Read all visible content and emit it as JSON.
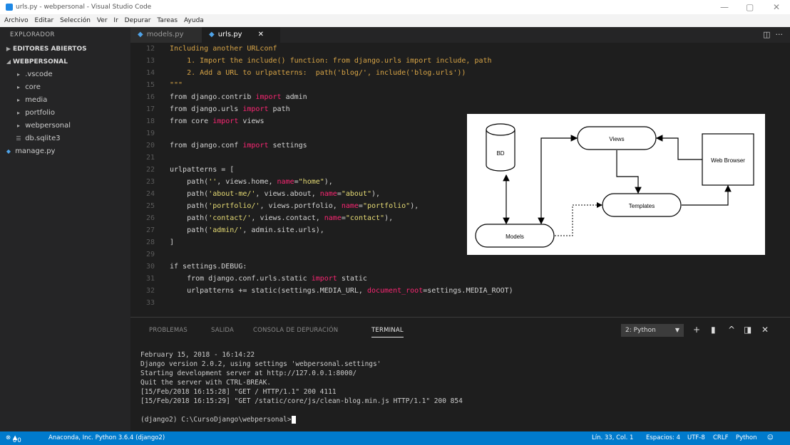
{
  "window": {
    "title": "urls.py - webpersonal - Visual Studio Code"
  },
  "menu": [
    "Archivo",
    "Editar",
    "Selección",
    "Ver",
    "Ir",
    "Depurar",
    "Tareas",
    "Ayuda"
  ],
  "sidebar": {
    "header": "EXPLORADOR",
    "sections": [
      {
        "label": "EDITORES ABIERTOS",
        "expanded": false
      },
      {
        "label": "WEBPERSONAL",
        "expanded": true
      }
    ],
    "items": [
      {
        "label": ".vscode",
        "icon": "chevron-right-icon"
      },
      {
        "label": "core",
        "icon": "chevron-right-icon"
      },
      {
        "label": "media",
        "icon": "chevron-right-icon"
      },
      {
        "label": "portfolio",
        "icon": "chevron-right-icon"
      },
      {
        "label": "webpersonal",
        "icon": "chevron-right-icon"
      },
      {
        "label": "db.sqlite3",
        "icon": "database-file-icon"
      },
      {
        "label": "manage.py",
        "icon": "python-file-icon"
      }
    ]
  },
  "tabs": [
    {
      "label": "models.py",
      "active": false
    },
    {
      "label": "urls.py",
      "active": true
    }
  ],
  "editor": {
    "lines": [
      {
        "n": "12",
        "tokens": [
          [
            "cmt",
            "Including another URLconf"
          ]
        ]
      },
      {
        "n": "13",
        "tokens": [
          [
            "cmt",
            "    1. Import the include() function: from django.urls import include, path"
          ]
        ]
      },
      {
        "n": "14",
        "tokens": [
          [
            "cmt",
            "    2. Add a URL to urlpatterns:  path('blog/', include('blog.urls'))"
          ]
        ]
      },
      {
        "n": "15",
        "tokens": [
          [
            "cmt",
            "\"\"\""
          ]
        ]
      },
      {
        "n": "16",
        "tokens": [
          [
            "code",
            "from django.contrib "
          ],
          [
            "kw",
            "import"
          ],
          [
            "code",
            " admin"
          ]
        ]
      },
      {
        "n": "17",
        "tokens": [
          [
            "code",
            "from django.urls "
          ],
          [
            "kw",
            "import"
          ],
          [
            "code",
            " path"
          ]
        ]
      },
      {
        "n": "18",
        "tokens": [
          [
            "code",
            "from core "
          ],
          [
            "kw",
            "import"
          ],
          [
            "code",
            " views"
          ]
        ]
      },
      {
        "n": "19",
        "tokens": []
      },
      {
        "n": "20",
        "tokens": [
          [
            "code",
            "from django.conf "
          ],
          [
            "kw",
            "import"
          ],
          [
            "code",
            " settings"
          ]
        ]
      },
      {
        "n": "21",
        "tokens": []
      },
      {
        "n": "22",
        "tokens": [
          [
            "code",
            "urlpatterns = ["
          ]
        ]
      },
      {
        "n": "23",
        "tokens": [
          [
            "code",
            "    path("
          ],
          [
            "str",
            "''"
          ],
          [
            "code",
            ", views.home, "
          ],
          [
            "kwarg",
            "name"
          ],
          [
            "code",
            "="
          ],
          [
            "str",
            "\"home\""
          ],
          [
            "code",
            "),"
          ]
        ]
      },
      {
        "n": "24",
        "tokens": [
          [
            "code",
            "    path("
          ],
          [
            "str",
            "'about-me/'"
          ],
          [
            "code",
            ", views.about, "
          ],
          [
            "kwarg",
            "name"
          ],
          [
            "code",
            "="
          ],
          [
            "str",
            "\"about\""
          ],
          [
            "code",
            "),"
          ]
        ]
      },
      {
        "n": "25",
        "tokens": [
          [
            "code",
            "    path("
          ],
          [
            "str",
            "'portfolio/'"
          ],
          [
            "code",
            ", views.portfolio, "
          ],
          [
            "kwarg",
            "name"
          ],
          [
            "code",
            "="
          ],
          [
            "str",
            "\"portfolio\""
          ],
          [
            "code",
            "),"
          ]
        ]
      },
      {
        "n": "26",
        "tokens": [
          [
            "code",
            "    path("
          ],
          [
            "str",
            "'contact/'"
          ],
          [
            "code",
            ", views.contact, "
          ],
          [
            "kwarg",
            "name"
          ],
          [
            "code",
            "="
          ],
          [
            "str",
            "\"contact\""
          ],
          [
            "code",
            "),"
          ]
        ]
      },
      {
        "n": "27",
        "tokens": [
          [
            "code",
            "    path("
          ],
          [
            "str",
            "'admin/'"
          ],
          [
            "code",
            ", admin.site.urls),"
          ]
        ]
      },
      {
        "n": "28",
        "tokens": [
          [
            "code",
            "]"
          ]
        ]
      },
      {
        "n": "29",
        "tokens": []
      },
      {
        "n": "30",
        "tokens": [
          [
            "code",
            "if settings.DEBUG:"
          ]
        ]
      },
      {
        "n": "31",
        "tokens": [
          [
            "code",
            "    from django.conf.urls.static "
          ],
          [
            "kw",
            "import"
          ],
          [
            "code",
            " static"
          ]
        ]
      },
      {
        "n": "32",
        "tokens": [
          [
            "code",
            "    urlpatterns += static(settings.MEDIA_URL, "
          ],
          [
            "kwarg",
            "document_root"
          ],
          [
            "code",
            "=settings.MEDIA_ROOT)"
          ]
        ]
      },
      {
        "n": "33",
        "tokens": []
      }
    ]
  },
  "diagram": {
    "nodes": {
      "db": "BD",
      "views": "Views",
      "browser": "Web Browser",
      "templates": "Templates",
      "models": "Models"
    }
  },
  "panel": {
    "tabs": [
      "PROBLEMAS",
      "SALIDA",
      "CONSOLA DE DEPURACIÓN",
      "TERMINAL"
    ],
    "active_tab": "TERMINAL",
    "terminal_select": "2: Python",
    "terminal_lines": [
      "February 15, 2018 - 16:14:22",
      "Django version 2.0.2, using settings 'webpersonal.settings'",
      "Starting development server at http://127.0.0.1:8000/",
      "Quit the server with CTRL-BREAK.",
      "[15/Feb/2018 16:15:28] \"GET / HTTP/1.1\" 200 4111",
      "[15/Feb/2018 16:15:29] \"GET /static/core/js/clean-blog.min.js HTTP/1.1\" 200 854",
      "",
      "(django2) C:\\CursoDjango\\webpersonal>"
    ]
  },
  "statusbar": {
    "errors": "0",
    "warnings": "0",
    "interpreter": "Anaconda, Inc. Python 3.6.4 (django2)",
    "position": "Lín. 33, Col. 1",
    "spaces": "Espacios: 4",
    "encoding": "UTF-8",
    "eol": "CRLF",
    "language": "Python"
  },
  "colors": {
    "statusbar": "#007acc",
    "keyword": "#f92672",
    "string": "#e6db74",
    "comment": "#d7a446"
  }
}
